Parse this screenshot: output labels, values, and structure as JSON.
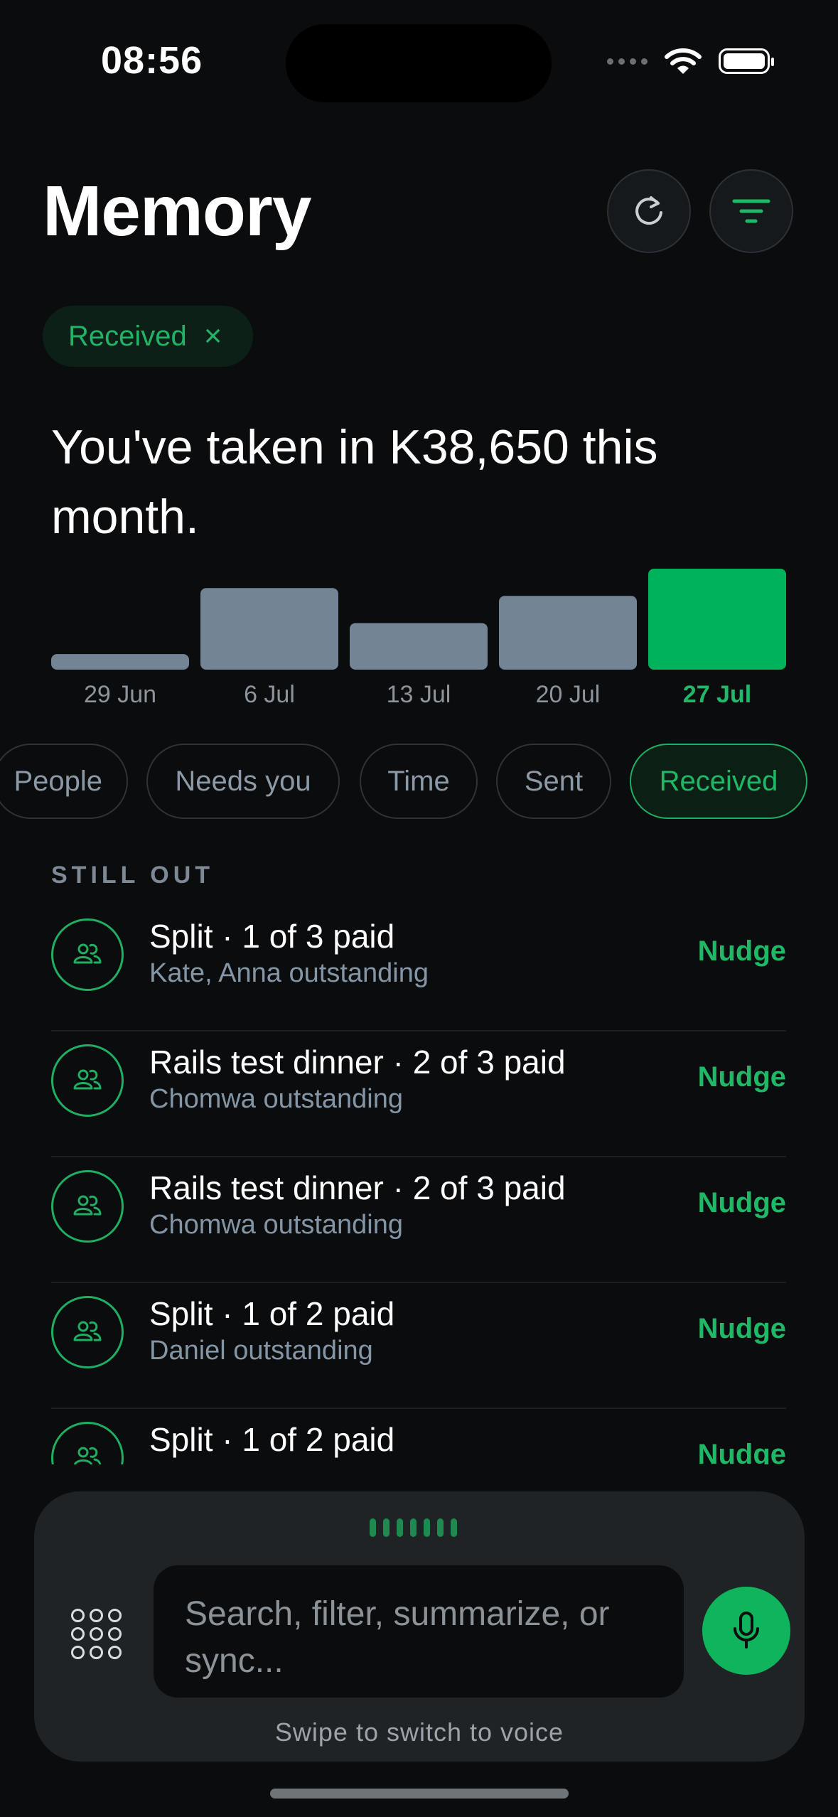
{
  "status_bar": {
    "time": "08:56"
  },
  "header": {
    "title": "Memory"
  },
  "active_filter_chip": {
    "label": "Received",
    "remove_icon": "×"
  },
  "summary": {
    "text": "You've taken in K38,650 this month."
  },
  "chart_data": {
    "type": "bar",
    "categories": [
      "29 Jun",
      "6 Jul",
      "13 Jul",
      "20 Jul",
      "27 Jul"
    ],
    "values": [
      2000,
      10500,
      6000,
      9500,
      13000
    ],
    "highlighted_category": "27 Jul",
    "colors": {
      "default": "#738595",
      "highlight": "#00b25a"
    }
  },
  "filter_pills": [
    {
      "label": "People",
      "selected": false
    },
    {
      "label": "Needs you",
      "selected": false
    },
    {
      "label": "Time",
      "selected": false
    },
    {
      "label": "Sent",
      "selected": false
    },
    {
      "label": "Received",
      "selected": true
    }
  ],
  "section": {
    "title": "STILL OUT"
  },
  "items": [
    {
      "title": "Split · 1 of 3 paid",
      "subtitle": "Kate, Anna outstanding",
      "action": "Nudge",
      "icon": "group-icon"
    },
    {
      "title": "Rails test dinner · 2 of 3 paid",
      "subtitle": "Chomwa outstanding",
      "action": "Nudge",
      "icon": "group-icon"
    },
    {
      "title": "Rails test dinner · 2 of 3 paid",
      "subtitle": "Chomwa outstanding",
      "action": "Nudge",
      "icon": "group-icon"
    },
    {
      "title": "Split · 1 of 2 paid",
      "subtitle": "Daniel outstanding",
      "action": "Nudge",
      "icon": "group-icon"
    },
    {
      "title": "Split · 1 of 2 paid",
      "subtitle": "",
      "action": "Nudge",
      "icon": "group-icon"
    }
  ],
  "composer": {
    "placeholder": "Search, filter, summarize, or sync...",
    "hint": "Swipe to switch to voice"
  },
  "colors": {
    "accent": "#1fb866",
    "background": "#0a0c0e",
    "panel": "#1f2326"
  }
}
